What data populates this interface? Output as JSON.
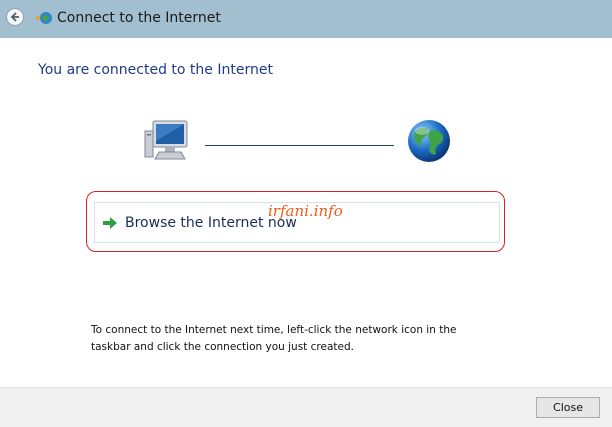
{
  "window": {
    "title": "Connect to the Internet"
  },
  "status": {
    "heading": "You are connected to the Internet"
  },
  "diagram": {
    "left_icon": "computer-icon",
    "right_icon": "globe-icon"
  },
  "option": {
    "label": "Browse the Internet now",
    "icon": "green-arrow-icon"
  },
  "watermark": {
    "text": "irfani.info"
  },
  "info": {
    "text": "To connect to the Internet next time, left-click the network icon in the taskbar and click the connection you just created."
  },
  "footer": {
    "close_label": "Close"
  },
  "colors": {
    "titlebar": "#a2bfcf",
    "heading": "#1f3c88",
    "highlight": "#d8222b",
    "watermark": "#f05a1a",
    "arrow": "#2ea043"
  }
}
